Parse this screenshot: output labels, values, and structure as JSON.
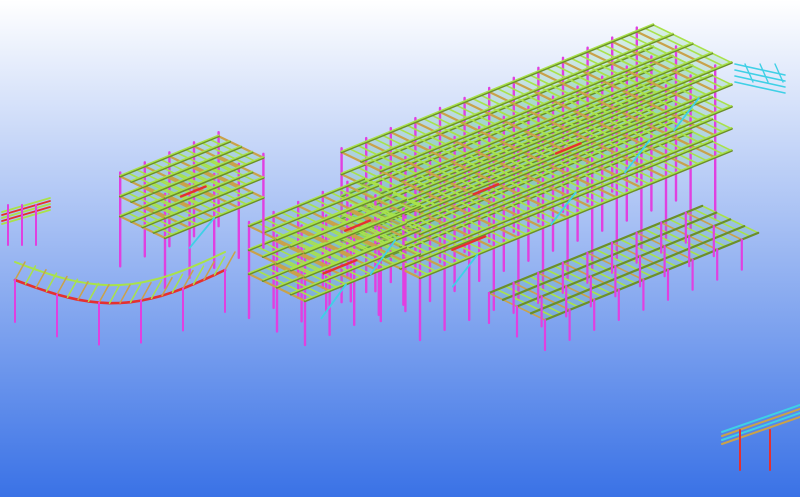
{
  "viewport": {
    "background_top": "#ffffff",
    "background_bottom": "#3a72e6"
  },
  "palette": {
    "beam": "#a9e24a",
    "beam_edge": "#6b8f2a",
    "girder": "#c9a24a",
    "column": "#e040e0",
    "brace": "#3fd0e6",
    "accent": "#e53030",
    "deck": "#55c977"
  }
}
